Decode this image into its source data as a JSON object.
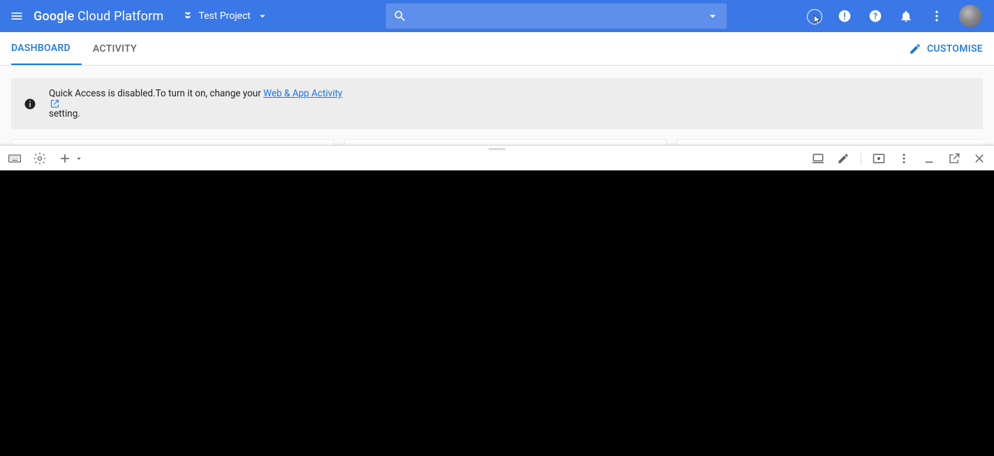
{
  "header": {
    "logo_prefix": "Google ",
    "logo_rest": "Cloud Platform",
    "project_name": "Test Project"
  },
  "tabs": {
    "dashboard": "DASHBOARD",
    "activity": "ACTIVITY",
    "customise": "CUSTOMISE"
  },
  "banner": {
    "prefix": "Quick Access is disabled.To turn it on, change your ",
    "link": "Web & App Activity",
    "suffix": "  setting."
  }
}
